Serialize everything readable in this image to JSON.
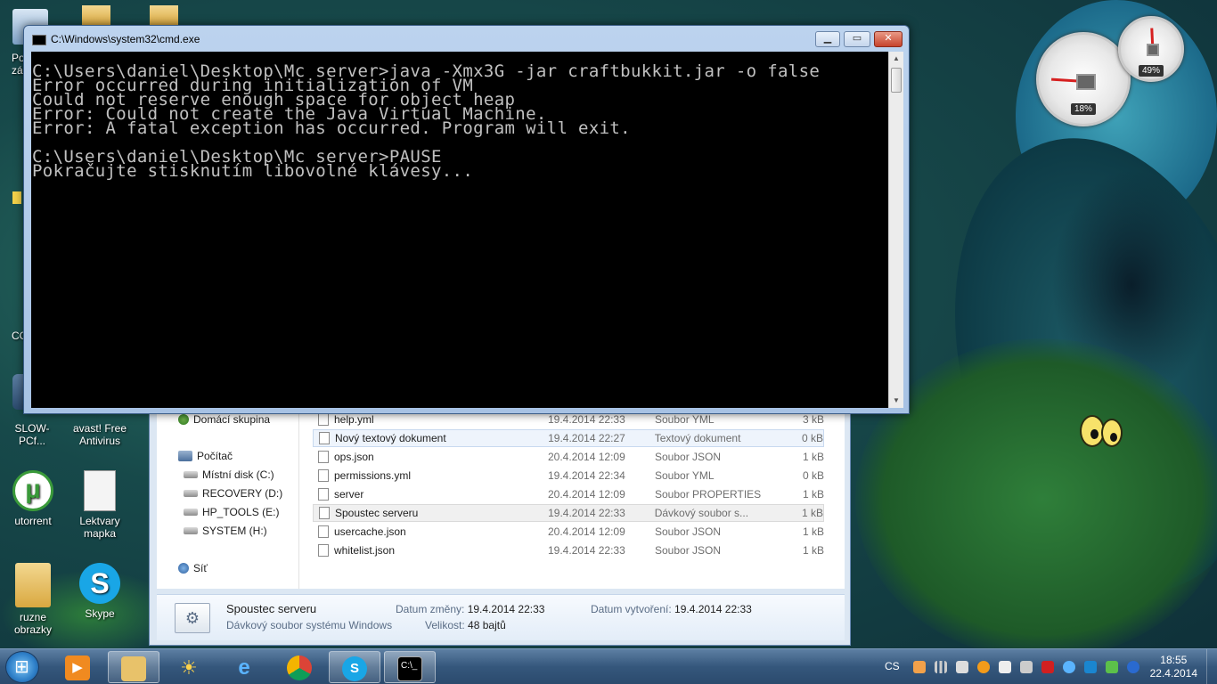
{
  "desktop": {
    "icons": [
      {
        "label": "SLOW-PCf...",
        "name": "desktop-icon-slow-pc"
      },
      {
        "label": "avast! Free Antivirus",
        "name": "desktop-icon-avast"
      },
      {
        "label": "utorrent",
        "name": "desktop-icon-utorrent"
      },
      {
        "label": "Lektvary mapka",
        "name": "desktop-icon-lektvary-mapka"
      },
      {
        "label": "ruzne obrazky",
        "name": "desktop-icon-ruzne-obrazky"
      },
      {
        "label": "Skype",
        "name": "desktop-icon-skype"
      }
    ],
    "partial_labels": [
      "Po",
      "zá",
      "CC"
    ]
  },
  "gadget": {
    "cpu_percent": "18%",
    "memory_percent": "49%",
    "cpu_value": 18,
    "memory_value": 49
  },
  "cmd": {
    "title": "C:\\Windows\\system32\\cmd.exe",
    "minimize": "▁",
    "maximize": "▭",
    "close": "✕",
    "lines": [
      "C:\\Users\\daniel\\Desktop\\Mc server>java -Xmx3G -jar craftbukkit.jar -o false",
      "Error occurred during initialization of VM",
      "Could not reserve enough space for object heap",
      "Error: Could not create the Java Virtual Machine.",
      "Error: A fatal exception has occurred. Program will exit.",
      "",
      "C:\\Users\\daniel\\Desktop\\Mc server>PAUSE",
      "Pokračujte stisknutím libovolné klávesy..."
    ]
  },
  "explorer": {
    "nav": {
      "homegroup": "Domácí skupina",
      "computer": "Počítač",
      "drives": [
        "Místní disk (C:)",
        "RECOVERY (D:)",
        "HP_TOOLS (E:)",
        "SYSTEM (H:)"
      ],
      "network": "Síť"
    },
    "files": [
      {
        "name": "help.yml",
        "date": "19.4.2014 22:33",
        "type": "Soubor YML",
        "size": "3 kB"
      },
      {
        "name": "Nový textový dokument",
        "date": "19.4.2014 22:27",
        "type": "Textový dokument",
        "size": "0 kB"
      },
      {
        "name": "ops.json",
        "date": "20.4.2014 12:09",
        "type": "Soubor JSON",
        "size": "1 kB"
      },
      {
        "name": "permissions.yml",
        "date": "19.4.2014 22:34",
        "type": "Soubor YML",
        "size": "0 kB"
      },
      {
        "name": "server",
        "date": "20.4.2014 12:09",
        "type": "Soubor PROPERTIES",
        "size": "1 kB"
      },
      {
        "name": "Spoustec serveru",
        "date": "19.4.2014 22:33",
        "type": "Dávkový soubor s...",
        "size": "1 kB"
      },
      {
        "name": "usercache.json",
        "date": "20.4.2014 12:09",
        "type": "Soubor JSON",
        "size": "1 kB"
      },
      {
        "name": "whitelist.json",
        "date": "19.4.2014 22:33",
        "type": "Soubor JSON",
        "size": "1 kB"
      }
    ],
    "details": {
      "name": "Spoustec serveru",
      "type": "Dávkový soubor systému Windows",
      "modified_label": "Datum změny:",
      "modified": "19.4.2014 22:33",
      "size_label": "Velikost:",
      "size": "48 bajtů",
      "created_label": "Datum vytvoření:",
      "created": "19.4.2014 22:33"
    }
  },
  "taskbar": {
    "language": "CS",
    "time": "18:55",
    "date": "22.4.2014"
  }
}
